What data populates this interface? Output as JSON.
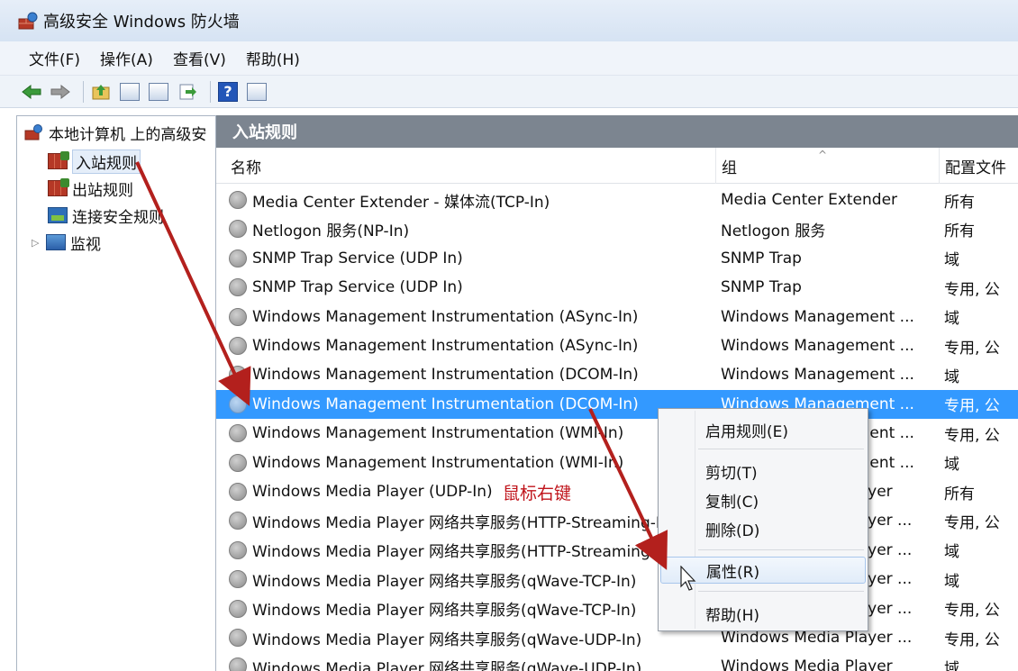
{
  "window": {
    "title": "高级安全 Windows 防火墙",
    "icon": "firewall-app-icon"
  },
  "menubar": [
    {
      "label": "文件(F)"
    },
    {
      "label": "操作(A)"
    },
    {
      "label": "查看(V)"
    },
    {
      "label": "帮助(H)"
    }
  ],
  "toolbar": [
    "back-arrow-icon",
    "forward-arrow-icon",
    "up-folder-icon",
    "show-hide-tree-icon",
    "export-list-icon",
    "help-icon",
    "action-pane-icon"
  ],
  "tree": {
    "root": "本地计算机 上的高级安",
    "items": [
      {
        "label": "入站规则",
        "selected": true
      },
      {
        "label": "出站规则"
      },
      {
        "label": "连接安全规则"
      },
      {
        "label": "监视",
        "expandable": true
      }
    ]
  },
  "content": {
    "header": "入站规则",
    "columns": {
      "name": "名称",
      "group": "组",
      "profile": "配置文件"
    },
    "rows": [
      {
        "name": "Media Center Extender - 媒体流(TCP-In)",
        "group": "Media Center Extender",
        "profile": "所有"
      },
      {
        "name": "Netlogon 服务(NP-In)",
        "group": "Netlogon 服务",
        "profile": "所有"
      },
      {
        "name": "SNMP Trap Service (UDP In)",
        "group": "SNMP Trap",
        "profile": "域"
      },
      {
        "name": "SNMP Trap Service (UDP In)",
        "group": "SNMP Trap",
        "profile": "专用, 公"
      },
      {
        "name": "Windows Management Instrumentation (ASync-In)",
        "group": "Windows Management ...",
        "profile": "域"
      },
      {
        "name": "Windows Management Instrumentation (ASync-In)",
        "group": "Windows Management ...",
        "profile": "专用, 公"
      },
      {
        "name": "Windows Management Instrumentation (DCOM-In)",
        "group": "Windows Management ...",
        "profile": "域"
      },
      {
        "name": "Windows Management Instrumentation (DCOM-In)",
        "group": "Windows Management ...",
        "profile": "专用, 公",
        "selected": true
      },
      {
        "name": "Windows Management Instrumentation (WMI-In)",
        "group": "Windows Management ...",
        "profile": "专用, 公"
      },
      {
        "name": "Windows Management Instrumentation (WMI-In)",
        "group": "Windows Management ...",
        "profile": "域"
      },
      {
        "name": "Windows Media Player (UDP-In)",
        "group": "Windows Media Player",
        "profile": "所有"
      },
      {
        "name": "Windows Media Player 网络共享服务(HTTP-Streaming-In)",
        "group": "Windows Media Player ...",
        "profile": "专用, 公"
      },
      {
        "name": "Windows Media Player 网络共享服务(HTTP-Streaming-In)",
        "group": "Windows Media Player ...",
        "profile": "域"
      },
      {
        "name": "Windows Media Player 网络共享服务(qWave-TCP-In)",
        "group": "Windows Media Player ...",
        "profile": "域"
      },
      {
        "name": "Windows Media Player 网络共享服务(qWave-TCP-In)",
        "group": "Windows Media Player ...",
        "profile": "专用, 公"
      },
      {
        "name": "Windows Media Player 网络共享服务(qWave-UDP-In)",
        "group": "Windows Media Player ...",
        "profile": "专用, 公"
      },
      {
        "name": "Windows Media Player 网络共享服务(qWave-UDP-In)",
        "group": "Windows Media Player",
        "profile": "域"
      }
    ]
  },
  "context_menu": {
    "items": [
      {
        "label": "启用规则(E)"
      },
      {
        "label": "剪切(T)"
      },
      {
        "label": "复制(C)"
      },
      {
        "label": "删除(D)"
      },
      {
        "label": "属性(R)",
        "hover": true
      },
      {
        "label": "帮助(H)"
      }
    ]
  },
  "annotation": {
    "text": "鼠标右键",
    "color": "#c0141b"
  },
  "colors": {
    "selection": "#3399ff",
    "header_bar": "#7c8590",
    "arrow": "#b3201d"
  }
}
